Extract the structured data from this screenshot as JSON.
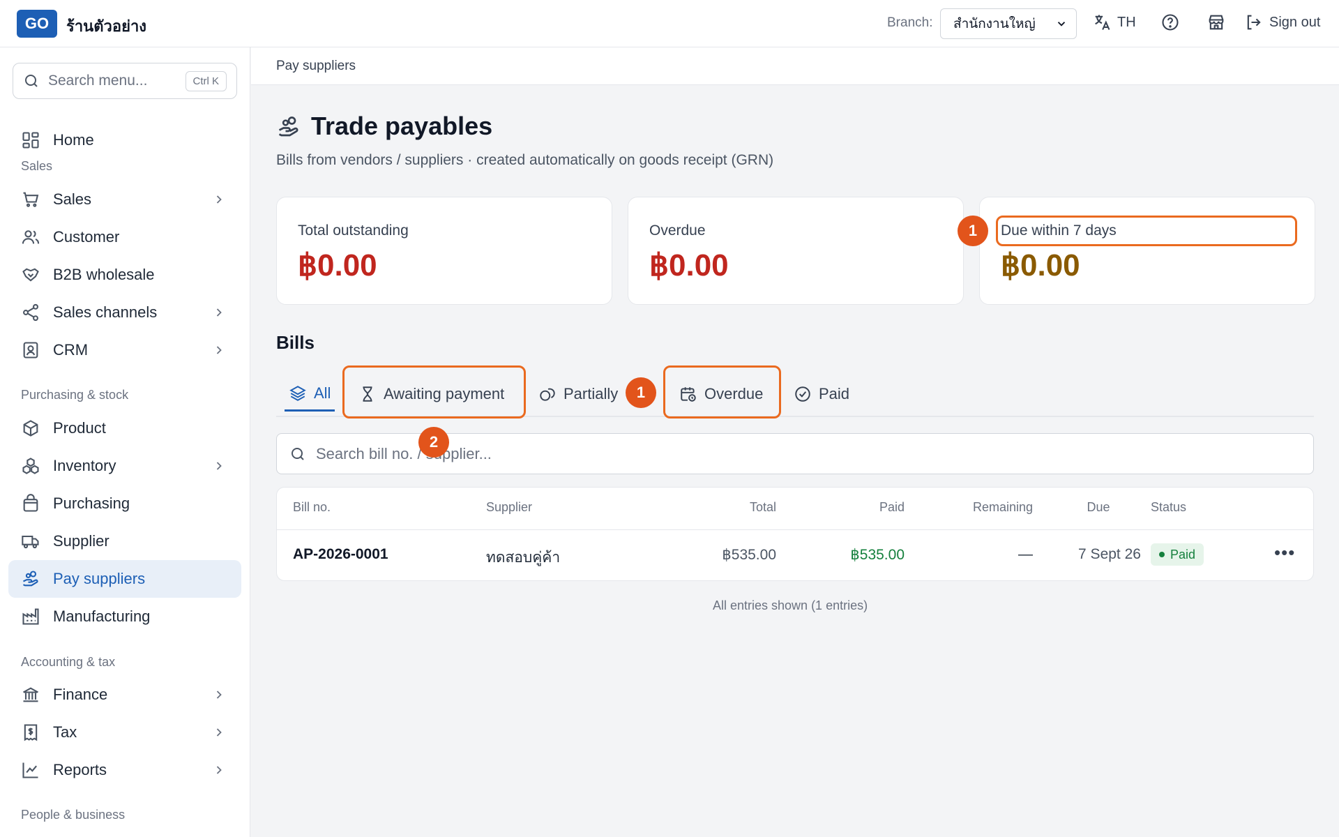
{
  "topbar": {
    "logo": "GO",
    "shop_name": "ร้านตัวอย่าง",
    "branch_label": "Branch:",
    "branch_value": "สำนักงานใหญ่",
    "language": "TH",
    "sign_out": "Sign out"
  },
  "sidebar": {
    "search_placeholder": "Search menu...",
    "search_shortcut": "Ctrl K",
    "home": "Home",
    "sections": {
      "sales": "Sales",
      "purchasing": "Purchasing & stock",
      "accounting": "Accounting & tax",
      "people": "People & business"
    },
    "items": {
      "sales": "Sales",
      "customer": "Customer",
      "b2b": "B2B wholesale",
      "channels": "Sales channels",
      "crm": "CRM",
      "product": "Product",
      "inventory": "Inventory",
      "purchasing": "Purchasing",
      "supplier": "Supplier",
      "pay_suppliers": "Pay suppliers",
      "manufacturing": "Manufacturing",
      "finance": "Finance",
      "tax": "Tax",
      "reports": "Reports"
    }
  },
  "breadcrumb": "Pay suppliers",
  "page": {
    "title": "Trade payables",
    "subtitle": "Bills from vendors / suppliers · created automatically on goods receipt (GRN)"
  },
  "cards": [
    {
      "label": "Total outstanding",
      "value": "฿0.00",
      "color": "#c0261e"
    },
    {
      "label": "Overdue",
      "value": "฿0.00",
      "color": "#c0261e"
    },
    {
      "label": "Due within 7 days",
      "value": "฿0.00",
      "color": "#8a5a00"
    }
  ],
  "bills": {
    "heading": "Bills",
    "tabs": {
      "all": "All",
      "awaiting": "Awaiting payment",
      "partial": "Partially paid",
      "overdue": "Overdue",
      "paid": "Paid"
    },
    "search_placeholder": "Search bill no. / supplier...",
    "columns": {
      "bill_no": "Bill no.",
      "supplier": "Supplier",
      "total": "Total",
      "paid": "Paid",
      "remaining": "Remaining",
      "due": "Due",
      "status": "Status"
    },
    "rows": [
      {
        "bill_no": "AP-2026-0001",
        "supplier": "ทดสอบคู่ค้า",
        "total": "฿535.00",
        "paid": "฿535.00",
        "remaining": "—",
        "due": "7 Sept 26",
        "status": "Paid"
      }
    ],
    "footer": "All entries shown (1 entries)"
  },
  "annotations": {
    "marker_a": "1",
    "marker_b": "1",
    "marker_c": "2"
  },
  "colors": {
    "accent": "#1d5fb5",
    "highlight": "#ea6a1f",
    "paid_green": "#15803d"
  }
}
